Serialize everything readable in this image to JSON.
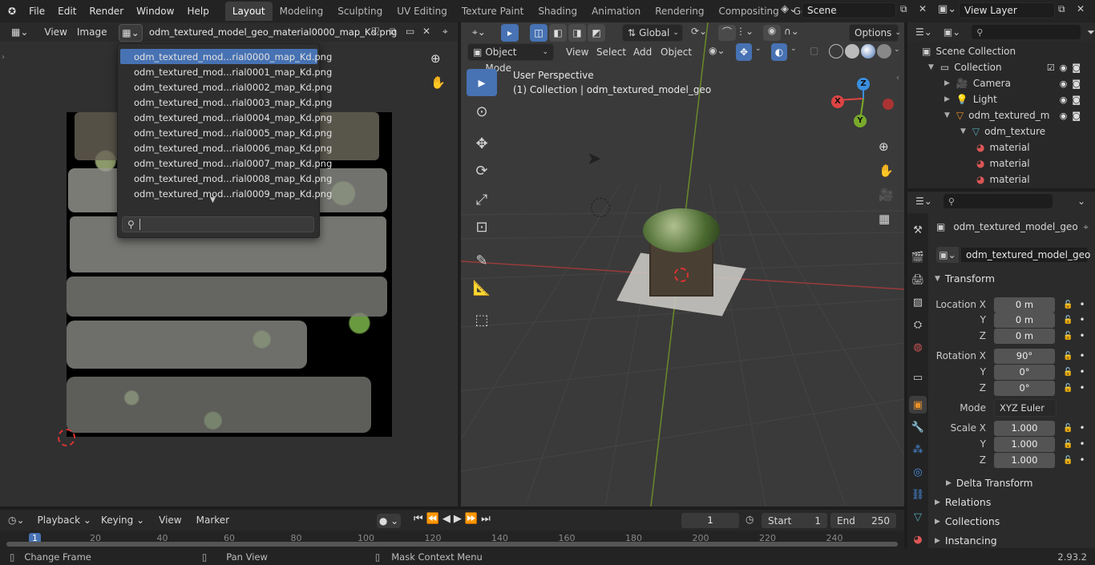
{
  "topbar": {
    "menus": [
      "File",
      "Edit",
      "Render",
      "Window",
      "Help"
    ],
    "workspaces": [
      "Layout",
      "Modeling",
      "Sculpting",
      "UV Editing",
      "Texture Paint",
      "Shading",
      "Animation",
      "Rendering",
      "Compositing",
      "Geometry Nod"
    ],
    "scene": "Scene",
    "view_layer": "View Layer"
  },
  "image_editor": {
    "menus": [
      "View",
      "Image"
    ],
    "image_name": "odm_textured_model_geo_material0000_map_Kd.png",
    "dropdown_items": [
      "odm_textured_mod...rial0000_map_Kd.png",
      "odm_textured_mod...rial0001_map_Kd.png",
      "odm_textured_mod...rial0002_map_Kd.png",
      "odm_textured_mod...rial0003_map_Kd.png",
      "odm_textured_mod...rial0004_map_Kd.png",
      "odm_textured_mod...rial0005_map_Kd.png",
      "odm_textured_mod...rial0006_map_Kd.png",
      "odm_textured_mod...rial0007_map_Kd.png",
      "odm_textured_mod...rial0008_map_Kd.png",
      "odm_textured_mod...rial0009_map_Kd.png"
    ],
    "search_placeholder": ""
  },
  "viewport": {
    "transform_orientation": "Global",
    "options": "Options",
    "mode": "Object Mode",
    "menus": [
      "View",
      "Select",
      "Add",
      "Object"
    ],
    "overlay_title": "User Perspective",
    "overlay_subtitle": "(1) Collection | odm_textured_model_geo",
    "gizmo": {
      "x": "X",
      "y": "Y",
      "z": "Z"
    }
  },
  "outliner": {
    "root": "Scene Collection",
    "items": [
      {
        "label": "Collection",
        "icon": "collection-icon"
      },
      {
        "label": "Camera",
        "icon": "camera-icon"
      },
      {
        "label": "Light",
        "icon": "light-icon"
      },
      {
        "label": "odm_textured_m",
        "icon": "mesh-object-icon"
      },
      {
        "label": "odm_texture",
        "icon": "mesh-data-icon"
      },
      {
        "label": "material",
        "icon": "material-icon"
      },
      {
        "label": "material",
        "icon": "material-icon"
      },
      {
        "label": "material",
        "icon": "material-icon"
      }
    ]
  },
  "properties": {
    "object_name": "odm_textured_model_geo",
    "object_field": "odm_textured_model_geo",
    "transform": {
      "title": "Transform",
      "location_label": "Location X",
      "location": [
        "0 m",
        "0 m",
        "0 m"
      ],
      "rotation_label": "Rotation X",
      "rotation": [
        "90°",
        "0°",
        "0°"
      ],
      "mode_label": "Mode",
      "mode": "XYZ Euler",
      "scale_label": "Scale X",
      "scale": [
        "1.000",
        "1.000",
        "1.000"
      ],
      "y": "Y",
      "z": "Z"
    },
    "delta": "Delta Transform",
    "sections": [
      "Relations",
      "Collections",
      "Instancing"
    ]
  },
  "timeline": {
    "menus": [
      "Playback",
      "Keying",
      "View",
      "Marker"
    ],
    "current_frame": "1",
    "start_label": "Start",
    "start": "1",
    "end_label": "End",
    "end": "250",
    "ruler": [
      "1",
      "20",
      "40",
      "60",
      "80",
      "100",
      "120",
      "140",
      "160",
      "180",
      "200",
      "220",
      "240"
    ]
  },
  "statusbar": {
    "items": [
      "Change Frame",
      "Pan View",
      "Mask Context Menu"
    ],
    "version": "2.93.2"
  }
}
